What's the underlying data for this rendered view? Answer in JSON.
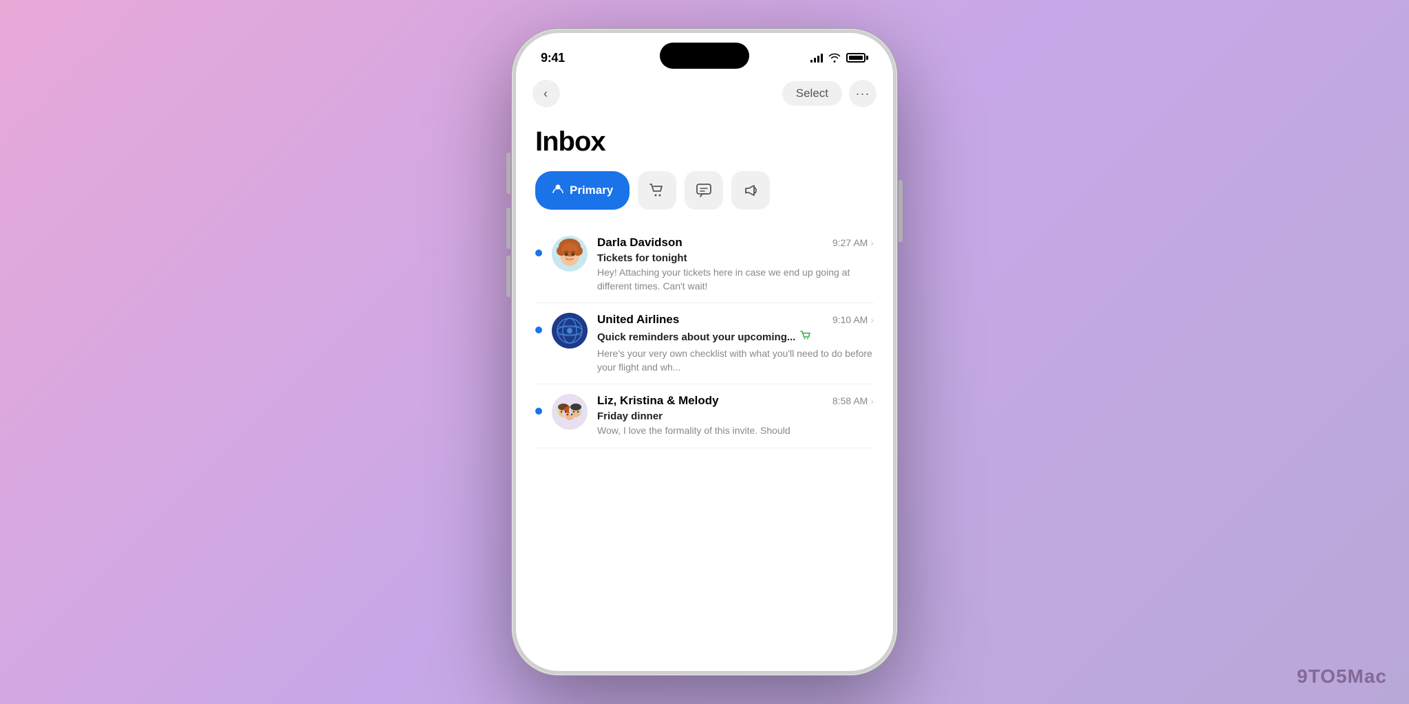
{
  "background": {
    "gradient_start": "#e8a8d8",
    "gradient_end": "#b8a8d8"
  },
  "watermark": "9TO5Mac",
  "phone": {
    "status_bar": {
      "time": "9:41",
      "signal_label": "signal",
      "wifi_label": "wifi",
      "battery_label": "battery"
    },
    "nav": {
      "back_label": "‹",
      "select_label": "Select",
      "more_label": "···"
    },
    "inbox": {
      "title": "Inbox",
      "tabs": [
        {
          "id": "primary",
          "label": "Primary",
          "icon": "person",
          "active": true
        },
        {
          "id": "shopping",
          "label": "Shopping",
          "icon": "cart",
          "active": false
        },
        {
          "id": "social",
          "label": "Social",
          "icon": "chat",
          "active": false
        },
        {
          "id": "promotions",
          "label": "Promotions",
          "icon": "megaphone",
          "active": false
        }
      ],
      "emails": [
        {
          "id": 1,
          "sender": "Darla Davidson",
          "time": "9:27 AM",
          "subject": "Tickets for tonight",
          "preview": "Hey! Attaching your tickets here in case we end up going at different times. Can't wait!",
          "unread": true,
          "avatar_type": "memoji_darla",
          "category_icon": null
        },
        {
          "id": 2,
          "sender": "United Airlines",
          "time": "9:10 AM",
          "subject": "Quick reminders about your upcoming...",
          "preview": "Here's your very own checklist with what you'll need to do before your flight and wh...",
          "unread": true,
          "avatar_type": "united_airlines",
          "category_icon": "cart"
        },
        {
          "id": 3,
          "sender": "Liz, Kristina & Melody",
          "time": "8:58 AM",
          "subject": "Friday dinner",
          "preview": "Wow, I love the formality of this invite. Should",
          "unread": true,
          "avatar_type": "group_memoji",
          "category_icon": null
        }
      ]
    }
  }
}
